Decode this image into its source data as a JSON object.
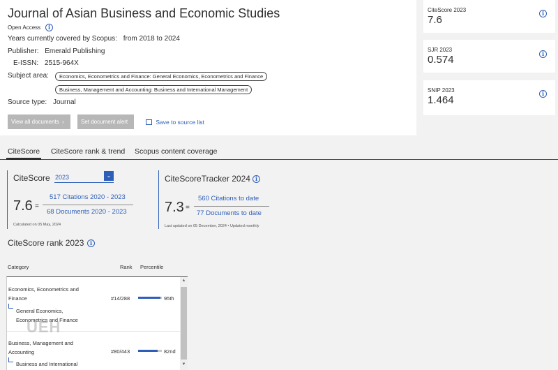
{
  "journal": {
    "title": "Journal of Asian Business and Economic Studies",
    "open_access": "Open Access",
    "years_label": "Years currently covered by Scopus:",
    "years_value": "from 2018 to 2024",
    "publisher_label": "Publisher:",
    "publisher_value": "Emerald Publishing",
    "eissn_label": "E-ISSN:",
    "eissn_value": "2515-964X",
    "subject_label": "Subject area:",
    "subjects": [
      "Economics, Econometrics and Finance: General Economics, Econometrics and Finance",
      "Business, Management and Accounting: Business and International Management"
    ],
    "source_type_label": "Source type:",
    "source_type_value": "Journal",
    "view_all_label": "View all documents",
    "set_alert_label": "Set document alert",
    "save_source_label": "Save to source list"
  },
  "metrics": [
    {
      "label": "CiteScore 2023",
      "value": "7.6"
    },
    {
      "label": "SJR 2023",
      "value": "0.574"
    },
    {
      "label": "SNIP 2023",
      "value": "1.464"
    }
  ],
  "tabs": [
    "CiteScore",
    "CiteScore rank & trend",
    "Scopus content coverage"
  ],
  "citescore": {
    "title": "CiteScore",
    "year": "2023",
    "value": "7.6",
    "eq": "=",
    "citations": "517 Citations 2020 - 2023",
    "documents": "68 Documents 2020 - 2023",
    "calculated": "Calculated on 05 May, 2024"
  },
  "tracker": {
    "title": "CiteScoreTracker 2024",
    "value": "7.3",
    "eq": "=",
    "citations": "560 Citations to date",
    "documents": "77 Documents to date",
    "updated": "Last updated on 05 December, 2024 • Updated monthly"
  },
  "rank": {
    "title": "CiteScore rank 2023",
    "col_category": "Category",
    "col_rank": "Rank",
    "col_percentile": "Percentile",
    "rows": [
      {
        "category": "Economics, Econometrics and Finance",
        "subcategory": "General Economics, Econometrics and Finance",
        "rank": "#14/288",
        "percentile_text": "95th",
        "percentile": 95
      },
      {
        "category": "Business, Management and Accounting",
        "subcategory": "Business and International",
        "rank": "#80/443",
        "percentile_text": "82nd",
        "percentile": 82
      }
    ]
  },
  "icons": {
    "info": "info-icon",
    "dropdown": "chevron-down-icon",
    "bookmark": "bookmark-icon",
    "arrow": "chevron-right-icon"
  },
  "colors": {
    "link_blue": "#2e5fb8",
    "button_grey": "#b7b7b7"
  }
}
